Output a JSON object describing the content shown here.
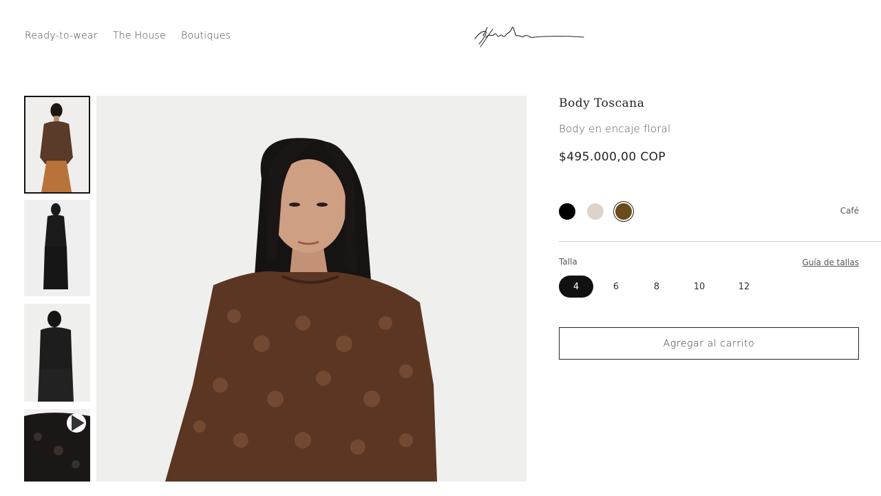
{
  "nav": {
    "items": [
      {
        "label": "Ready-to-wear"
      },
      {
        "label": "The House"
      },
      {
        "label": "Boutiques"
      }
    ]
  },
  "product": {
    "title": "Body Toscana",
    "subtitle": "Body en encaje floral",
    "price": "$495.000,00 COP"
  },
  "colors": {
    "options": [
      {
        "hex": "#000000"
      },
      {
        "hex": "#ddd3cb"
      },
      {
        "hex": "#6b4a1c"
      }
    ],
    "selected_index": 2,
    "selected_name": "Café"
  },
  "sizes": {
    "label": "Talla",
    "guide_label": "Guía de tallas",
    "options": [
      "4",
      "6",
      "8",
      "10",
      "12"
    ],
    "selected_index": 0
  },
  "cart": {
    "add_label": "Agregar al carrito"
  },
  "gallery": {
    "active_thumb_index": 0,
    "thumbs": [
      {
        "kind": "image",
        "color": "brown-lace"
      },
      {
        "kind": "image",
        "color": "black-lace"
      },
      {
        "kind": "image",
        "color": "black-lace-back"
      },
      {
        "kind": "video",
        "color": "black-lace-detail",
        "icon": "play-icon"
      }
    ]
  }
}
